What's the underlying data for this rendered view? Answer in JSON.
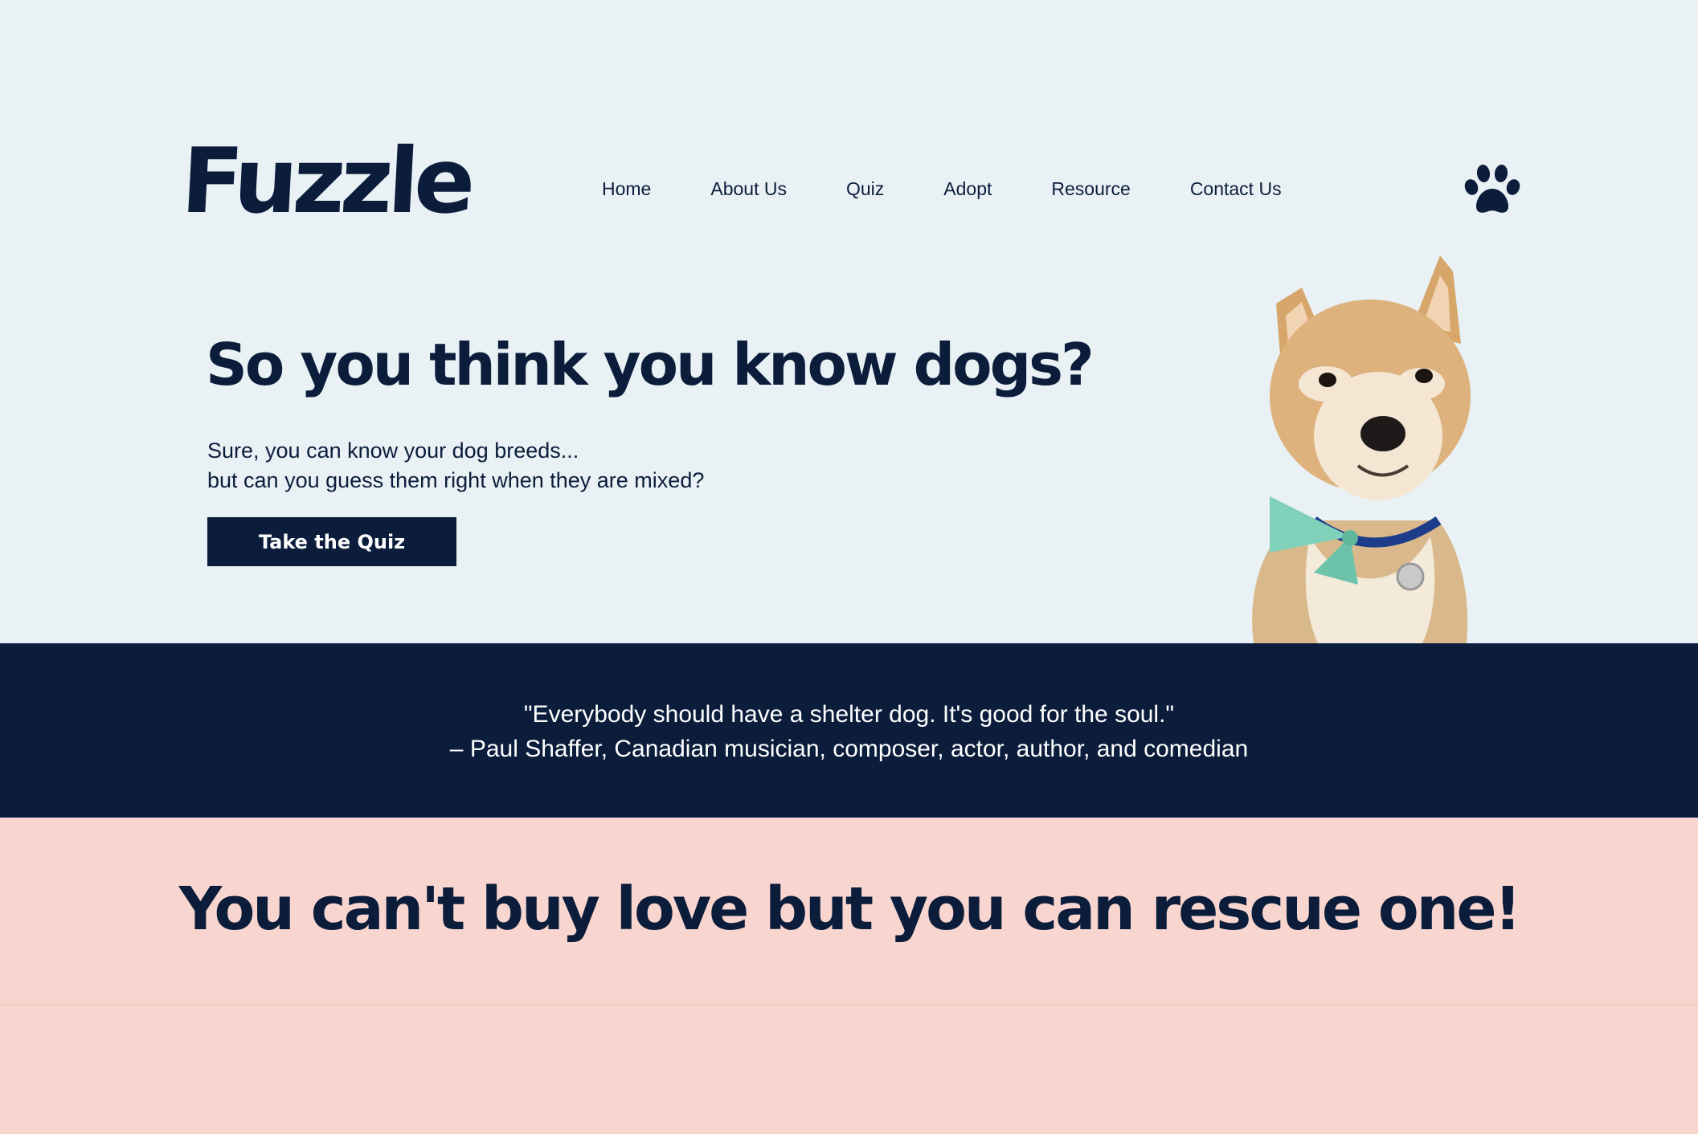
{
  "brand": {
    "logo": "Fuzzle"
  },
  "nav": {
    "items": [
      "Home",
      "About Us",
      "Quiz",
      "Adopt",
      "Resource",
      "Contact Us"
    ]
  },
  "icons": {
    "header_icon": "paw-icon"
  },
  "hero": {
    "heading": "So you think you know dogs?",
    "sub_line1": "Sure, you can know your dog breeds...",
    "sub_line2": "but can you guess them right when they are mixed?",
    "cta_label": "Take the Quiz"
  },
  "quote": {
    "text": "\"Everybody should have a shelter dog. It's good for the soul.\"",
    "attribution": "– Paul Shaffer, Canadian musician, composer, actor, author, and comedian"
  },
  "rescue": {
    "heading": "You can't buy love but you can rescue one!"
  },
  "colors": {
    "navy": "#0b1d3b",
    "hero_bg": "#e9f1f5",
    "pink_bg": "#f9d5cf",
    "bowtie": "#7fd1b9"
  }
}
